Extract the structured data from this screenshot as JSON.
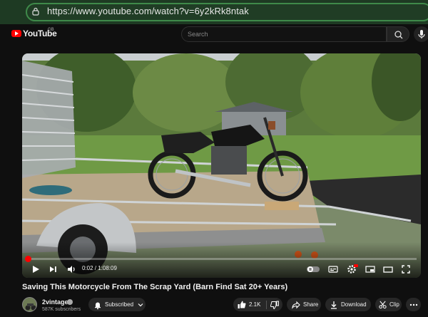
{
  "browser": {
    "url": "https://www.youtube.com/watch?v=6y2kRk8ntak"
  },
  "header": {
    "logo_text": "YouTube",
    "country_code": "GB",
    "search_placeholder": "Search"
  },
  "player": {
    "current_time": "0:02",
    "duration": "1:08:09",
    "time_display": "0:02 / 1:08:09",
    "progress_fraction": 0.0005,
    "settings_badge": "HD",
    "icons": [
      "play-icon",
      "next-icon",
      "volume-icon",
      "autoplay-toggle",
      "subtitles-icon",
      "settings-icon",
      "miniplayer-icon",
      "theater-icon",
      "fullscreen-icon"
    ]
  },
  "video": {
    "title": "Saving This Motorcycle From The Scrap Yard (Barn Find Sat 20+ Years)"
  },
  "channel": {
    "name": "2vintage",
    "subscribers": "587K subscribers",
    "subscribe_label": "Subscribed"
  },
  "actions": {
    "like_count": "2.1K",
    "share_label": "Share",
    "download_label": "Download",
    "clip_label": "Clip"
  },
  "colors": {
    "accent": "#ff0000",
    "background": "#0f0f0f",
    "browser_bar": "#1e3a23"
  }
}
